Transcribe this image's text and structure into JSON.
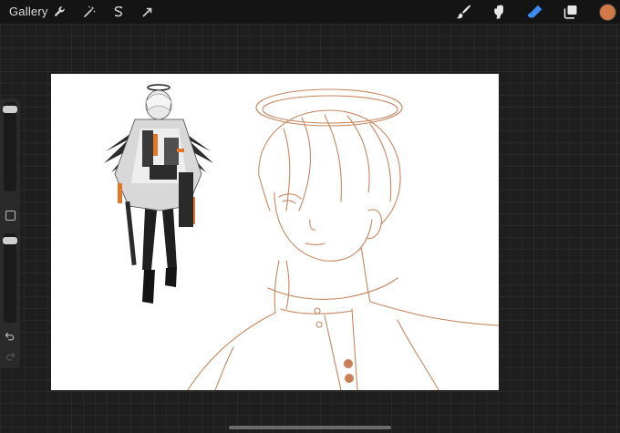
{
  "topbar": {
    "gallery_label": "Gallery",
    "left_tools": [
      "wrench-icon",
      "magic-wand-icon",
      "selection-icon",
      "transform-icon"
    ],
    "right_tools": [
      "brush-icon",
      "smudge-icon",
      "eraser-icon",
      "layers-icon"
    ],
    "active_tool": "eraser-icon",
    "current_color": "#d17a48"
  },
  "sidebar": {
    "brush_size_level": 0.05,
    "opacity_level": 0.05,
    "controls": [
      "brush-size-slider",
      "modify-button",
      "opacity-slider",
      "undo-icon",
      "redo-icon"
    ]
  },
  "canvas": {
    "content": [
      "reference-character-illustration",
      "orange-line-sketch"
    ],
    "sketch_color": "#c58660",
    "accent_color": "#e0772a"
  }
}
